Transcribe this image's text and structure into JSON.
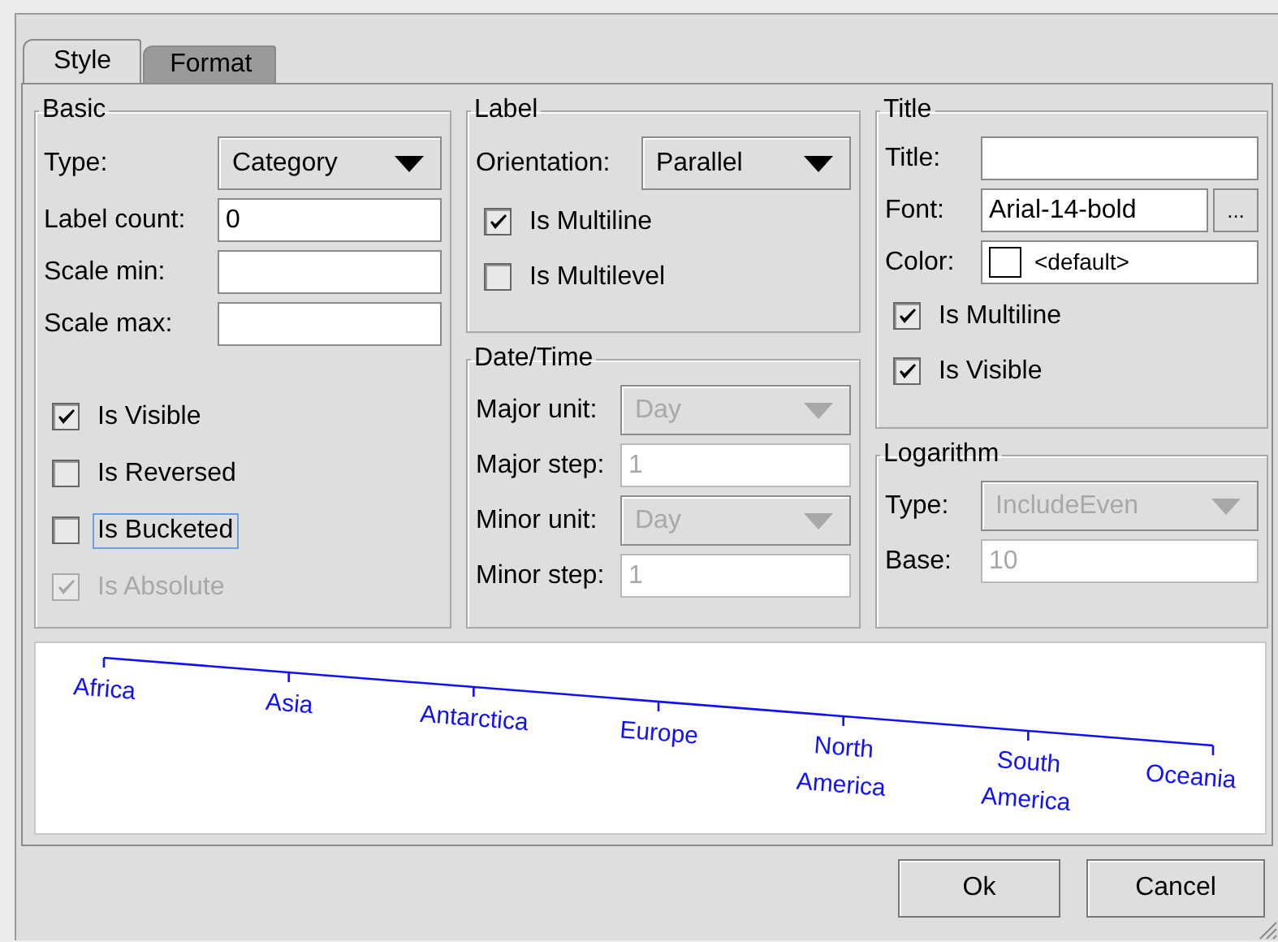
{
  "tabs": [
    {
      "label": "Style",
      "selected": true
    },
    {
      "label": "Format",
      "selected": false
    }
  ],
  "columns": [
    {
      "groups": [
        {
          "title": "Basic",
          "rows": [
            {
              "kind": "combo",
              "label": "Type:",
              "value": "Category",
              "disabled": false
            },
            {
              "kind": "text",
              "label": "Label count:",
              "value": "0",
              "disabled": false
            },
            {
              "kind": "text",
              "label": "Scale min:",
              "disabled": false
            },
            {
              "kind": "text",
              "label": "Scale max:",
              "disabled": false
            }
          ],
          "checkboxes": [
            {
              "label": "Is Visible",
              "checked": true,
              "disabled": false,
              "focused": false
            },
            {
              "label": "Is Reversed",
              "checked": false,
              "disabled": false,
              "focused": false
            },
            {
              "label": "Is Bucketed",
              "checked": false,
              "disabled": false,
              "focused": true
            },
            {
              "label": "Is Absolute",
              "checked": true,
              "disabled": true,
              "focused": false
            }
          ]
        }
      ]
    },
    {
      "groups": [
        {
          "title": "Label",
          "rows": [
            {
              "kind": "combo",
              "label": "Orientation:",
              "value": "Parallel",
              "disabled": false
            }
          ],
          "checkboxes": [
            {
              "label": "Is Multiline",
              "checked": true,
              "disabled": false,
              "focused": false
            },
            {
              "label": "Is Multilevel",
              "checked": false,
              "disabled": false,
              "focused": false
            }
          ]
        },
        {
          "title": "Date/Time",
          "rows": [
            {
              "kind": "combo",
              "label": "Major unit:",
              "value": "Day",
              "disabled": true
            },
            {
              "kind": "text",
              "label": "Major step:",
              "value": "1",
              "disabled": true
            },
            {
              "kind": "combo",
              "label": "Minor unit:",
              "value": "Day",
              "disabled": true
            },
            {
              "kind": "text",
              "label": "Minor step:",
              "value": "1",
              "disabled": true
            }
          ]
        }
      ]
    },
    {
      "groups": [
        {
          "title": "Title",
          "rows": [
            {
              "kind": "text",
              "label": "Title:",
              "disabled": false
            },
            {
              "kind": "font",
              "label": "Font:",
              "value": "Arial-14-bold",
              "button": "...",
              "disabled": false
            },
            {
              "kind": "color",
              "label": "Color:",
              "value": "<default>",
              "disabled": false
            }
          ],
          "checkboxes": [
            {
              "label": "Is Multiline",
              "checked": true,
              "disabled": false,
              "focused": false
            },
            {
              "label": "Is Visible",
              "checked": true,
              "disabled": false,
              "focused": false
            }
          ]
        },
        {
          "title": "Logarithm",
          "rows": [
            {
              "kind": "combo",
              "label": "Type:",
              "value": "IncludeEven",
              "disabled": true
            },
            {
              "kind": "text",
              "label": "Base:",
              "value": "10",
              "disabled": true
            }
          ]
        }
      ]
    }
  ],
  "preview": {
    "labels": [
      "Africa",
      "Asia",
      "Antarctica",
      "Europe",
      "North America",
      "South America",
      "Oceania"
    ]
  },
  "buttons": [
    "Ok",
    "Cancel"
  ]
}
